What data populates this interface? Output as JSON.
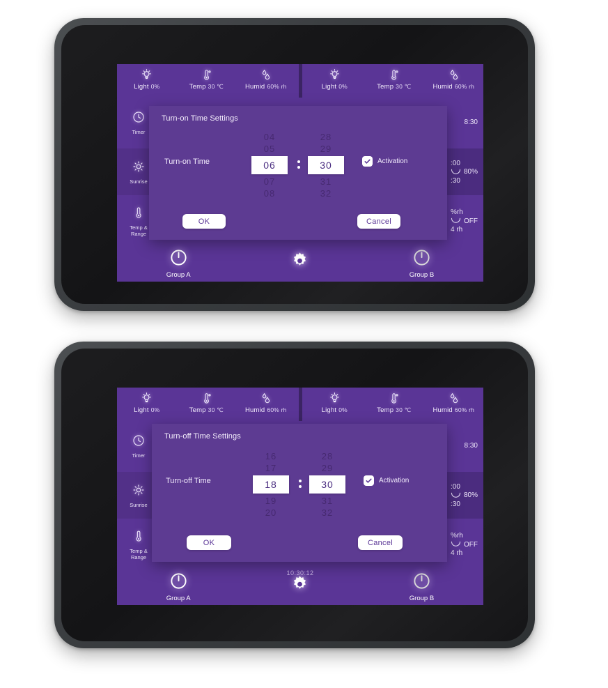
{
  "devices": [
    {
      "id": "device-turn-on",
      "status_left": {
        "cells": [
          {
            "icon": "light-bulb-icon",
            "label": "Light",
            "value": "0%"
          },
          {
            "icon": "thermometer-icon",
            "label": "Temp",
            "value": "30 ℃"
          },
          {
            "icon": "humidity-drop-icon",
            "label": "Humid",
            "value": "60% rh"
          }
        ]
      },
      "status_right": {
        "cells": [
          {
            "icon": "light-bulb-icon",
            "label": "Light",
            "value": "0%"
          },
          {
            "icon": "thermometer-icon",
            "label": "Temp",
            "value": "30 ℃"
          },
          {
            "icon": "humidity-drop-icon",
            "label": "Humid",
            "value": "60% rh"
          }
        ]
      },
      "sidebar": [
        {
          "icon": "clock-icon",
          "label": "Timer"
        },
        {
          "icon": "sunrise-icon",
          "label": "Sunrise"
        },
        {
          "icon": "thermometer-icon",
          "label": "Temp &\nRange"
        }
      ],
      "content_rows": [
        {
          "lines": [
            "8:30"
          ]
        },
        {
          "lines": [
            ":00",
            "80%",
            ":30"
          ]
        },
        {
          "lines": [
            "%rh",
            "OFF",
            "4 rh"
          ]
        }
      ],
      "bottom_nav": [
        {
          "icon": "power-icon",
          "label": "Group A"
        },
        {
          "icon": "gear-icon",
          "label": ""
        },
        {
          "icon": "power-icon",
          "label": "Group B"
        }
      ],
      "clock": "",
      "dialog": {
        "title": "Turn-on Time  Settings",
        "field_label": "Turn-on Time",
        "hours": {
          "above": [
            "04",
            "05"
          ],
          "selected": "06",
          "below": [
            "07",
            "08"
          ]
        },
        "minutes": {
          "above": [
            "28",
            "29"
          ],
          "selected": "30",
          "below": [
            "31",
            "32"
          ]
        },
        "activation_label": "Activation",
        "activation_checked": true,
        "ok_label": "OK",
        "cancel_label": "Cancel"
      }
    },
    {
      "id": "device-turn-off",
      "status_left": {
        "cells": [
          {
            "icon": "light-bulb-icon",
            "label": "Light",
            "value": "0%"
          },
          {
            "icon": "thermometer-icon",
            "label": "Temp",
            "value": "30 ℃"
          },
          {
            "icon": "humidity-drop-icon",
            "label": "Humid",
            "value": "60% rh"
          }
        ]
      },
      "status_right": {
        "cells": [
          {
            "icon": "light-bulb-icon",
            "label": "Light",
            "value": "0%"
          },
          {
            "icon": "thermometer-icon",
            "label": "Temp",
            "value": "30 ℃"
          },
          {
            "icon": "humidity-drop-icon",
            "label": "Humid",
            "value": "60% rh"
          }
        ]
      },
      "sidebar": [
        {
          "icon": "clock-icon",
          "label": "Timer"
        },
        {
          "icon": "sunrise-icon",
          "label": "Sunrise"
        },
        {
          "icon": "thermometer-icon",
          "label": "Temp &\nRange"
        }
      ],
      "content_rows": [
        {
          "lines": [
            "8:30"
          ]
        },
        {
          "lines": [
            ":00",
            "80%",
            ":30"
          ]
        },
        {
          "lines": [
            "%rh",
            "OFF",
            "4 rh"
          ]
        }
      ],
      "bottom_nav": [
        {
          "icon": "power-icon",
          "label": "Group A"
        },
        {
          "icon": "gear-icon",
          "label": ""
        },
        {
          "icon": "power-icon",
          "label": "Group B"
        }
      ],
      "clock": "10:30:12",
      "dialog": {
        "title": "Turn-off Time Settings",
        "field_label": "Turn-off Time",
        "hours": {
          "above": [
            "16",
            "17"
          ],
          "selected": "18",
          "below": [
            "19",
            "20"
          ]
        },
        "minutes": {
          "above": [
            "28",
            "29"
          ],
          "selected": "30",
          "below": [
            "31",
            "32"
          ]
        },
        "activation_label": "Activation",
        "activation_checked": true,
        "ok_label": "OK",
        "cancel_label": "Cancel"
      }
    }
  ],
  "colors": {
    "screen_purple": "#5a3596",
    "dialog_purple": "#5d3b92",
    "row_alt": "#4b2c7f",
    "selection_white": "#ffffff",
    "digit_text": "#4a2d80",
    "bezel_dark": "#2e3133"
  }
}
